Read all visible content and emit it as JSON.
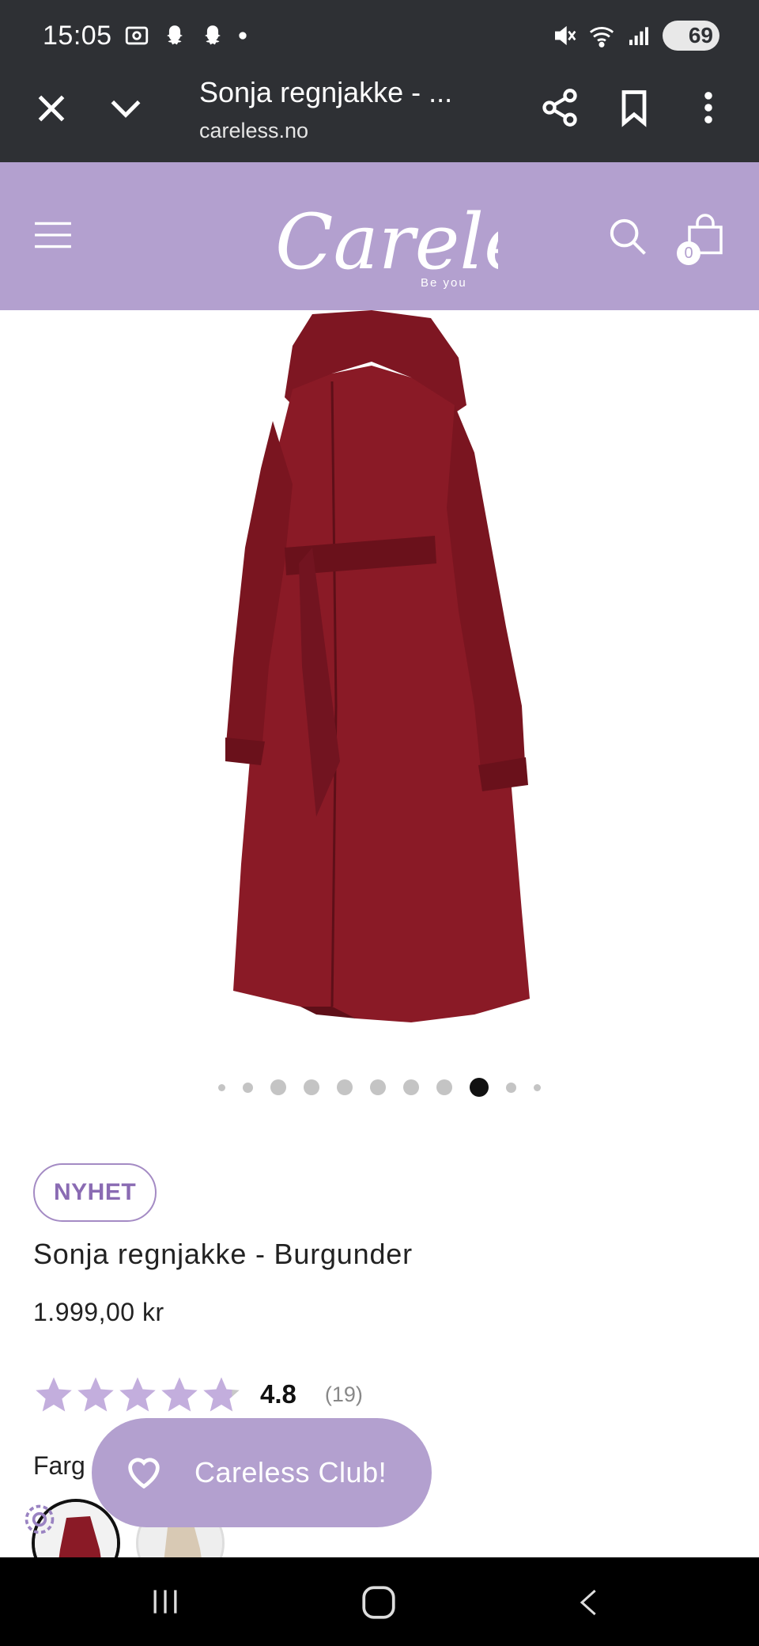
{
  "status_bar": {
    "time": "15:05",
    "battery": "69",
    "icons_left": [
      "screenshot-icon",
      "snapchat-icon",
      "snapchat-icon",
      "dot-icon"
    ],
    "icons_right": [
      "mute-icon",
      "wifi-icon",
      "signal-icon",
      "battery-icon"
    ]
  },
  "browser": {
    "page_title": "Sonja regnjakke - ...",
    "domain": "careless.no",
    "icons": [
      "close-icon",
      "chevron-down-icon",
      "share-icon",
      "bookmark-icon",
      "more-icon"
    ]
  },
  "site_header": {
    "background": "#b3a0cf",
    "logo_text": "Careless",
    "logo_tagline": "Be you",
    "cart_count": "0",
    "icons": [
      "menu-icon",
      "search-icon",
      "shopping-bag-icon"
    ]
  },
  "product": {
    "image_colors": {
      "coat": "#8a1a26",
      "coat_shadow": "#6a111b"
    },
    "gallery_dot_count": 11,
    "gallery_active_index": 8,
    "badge": "NYHET",
    "title": "Sonja regnjakke - Burgunder",
    "price": "1.999,00 kr",
    "rating_value": "4.8",
    "rating_count": "(19)",
    "rating_stars": 4.8,
    "color_label": "Farg"
  },
  "club_button": {
    "label": "Careless Club!",
    "icon": "heart-icon"
  },
  "nav_bar": {
    "icons": [
      "recent-apps-icon",
      "home-icon",
      "back-icon"
    ]
  }
}
